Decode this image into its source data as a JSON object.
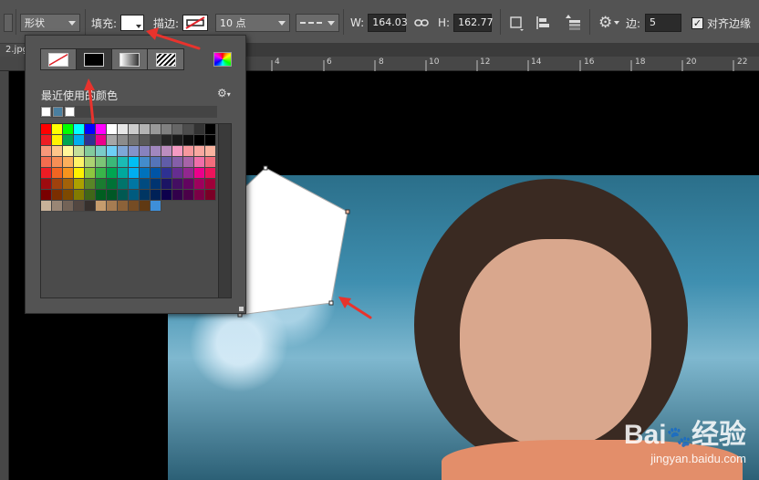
{
  "options_bar": {
    "mode_label": "形状",
    "fill_label": "填充:",
    "stroke_label": "描边:",
    "stroke_size": "10 点",
    "w_label": "W:",
    "w_value": "164.03",
    "h_label": "H:",
    "h_value": "162.77",
    "sides_label": "边:",
    "sides_value": "5",
    "align_edges_label": "对齐边缘",
    "align_edges_checked": true
  },
  "document": {
    "tab_label": "2.jpg",
    "ruler_ticks": [
      "4",
      "6",
      "8",
      "10",
      "12",
      "14",
      "16",
      "18",
      "20",
      "22"
    ]
  },
  "color_picker": {
    "recent_title": "最近使用的颜色",
    "swatch_types": [
      "no-color",
      "solid-color",
      "gradient",
      "pattern"
    ],
    "selected_type": "solid-color",
    "recent_colors": [
      "#ffffff",
      "#4a7fa0",
      "#ffffff"
    ],
    "swatch_rows": [
      [
        "#ff0000",
        "#ffff00",
        "#00ff00",
        "#00ffff",
        "#0000ff",
        "#ff00ff",
        "#ffffff",
        "#e6e6e6",
        "#cccccc",
        "#b3b3b3",
        "#999999",
        "#808080",
        "#666666",
        "#4d4d4d",
        "#333333",
        "#000000"
      ],
      [
        "#ed1c24",
        "#fff200",
        "#00a651",
        "#00aeef",
        "#2e3192",
        "#ec008c",
        "#a6a6a6",
        "#8c8c8c",
        "#737373",
        "#595959",
        "#404040",
        "#262626",
        "#1a1a1a",
        "#0d0d0d",
        "#000000",
        "#000000"
      ],
      [
        "#f7977a",
        "#fdc68a",
        "#fff79a",
        "#c4df9b",
        "#82ca9c",
        "#7accc8",
        "#6dcff6",
        "#7ea7d8",
        "#8493ca",
        "#8882be",
        "#a187be",
        "#bc8dbf",
        "#f49ac2",
        "#f6989d",
        "#f9a8a0",
        "#fbb4a0"
      ],
      [
        "#f26c4f",
        "#f68e55",
        "#fbaf5c",
        "#fff467",
        "#acd372",
        "#7cc576",
        "#3bb878",
        "#1abbb4",
        "#00bff3",
        "#438ccb",
        "#5574b9",
        "#605ca8",
        "#855fa8",
        "#a763a8",
        "#f06ea9",
        "#f26d7d"
      ],
      [
        "#ed1c24",
        "#f26522",
        "#f7941d",
        "#fff200",
        "#8dc63f",
        "#39b54a",
        "#00a651",
        "#00a99d",
        "#00aeef",
        "#0072bc",
        "#0054a6",
        "#2e3192",
        "#662d91",
        "#92278f",
        "#ec008c",
        "#ed145b"
      ],
      [
        "#9e0b0f",
        "#a0410d",
        "#a36209",
        "#aba000",
        "#598527",
        "#1a7b30",
        "#007236",
        "#00746b",
        "#0076a3",
        "#004b80",
        "#003471",
        "#1b1464",
        "#440e62",
        "#630460",
        "#9e005d",
        "#9e0039"
      ],
      [
        "#790000",
        "#7b2e00",
        "#7d4900",
        "#827b00",
        "#406618",
        "#005e20",
        "#005826",
        "#005952",
        "#005b7f",
        "#003663",
        "#002157",
        "#0d004c",
        "#32004b",
        "#4b0049",
        "#7b0046",
        "#7a0026"
      ],
      [
        "#c7b299",
        "#998675",
        "#736357",
        "#534741",
        "#37302d",
        "#c69c6d",
        "#a67c52",
        "#8c6239",
        "#754c24",
        "#603913",
        "#3e8fd8"
      ]
    ]
  }
}
